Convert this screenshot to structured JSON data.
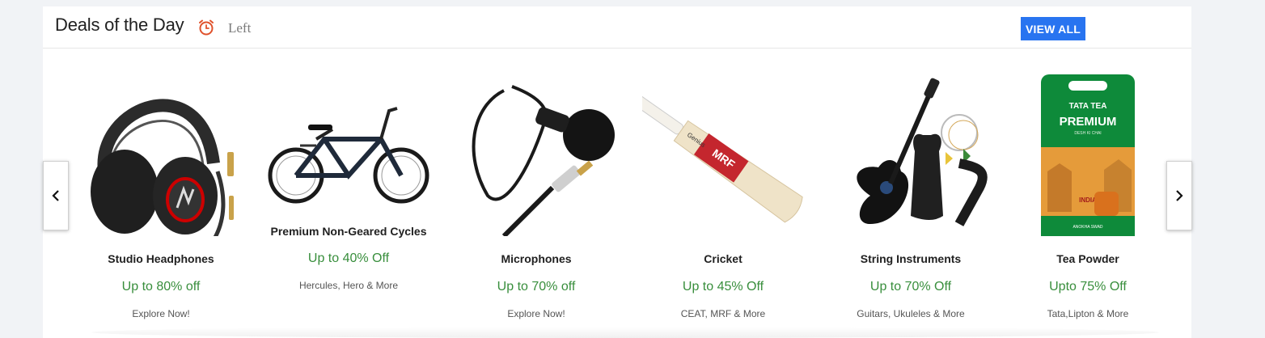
{
  "header": {
    "title": "Deals of the Day",
    "timer_icon": "alarm-clock-icon",
    "time_left_label": "Left",
    "view_all_label": "VIEW ALL"
  },
  "accent_color": "#2874f0",
  "offer_color": "#388e3c",
  "deals": [
    {
      "name": "Studio Headphones",
      "offer": "Up to 80% off",
      "sub": "Explore Now!",
      "image": "headphones-image"
    },
    {
      "name": "Premium Non-Geared Cycles",
      "offer": "Up to 40% Off",
      "sub": "Hercules, Hero & More",
      "image": "bicycle-image"
    },
    {
      "name": "Microphones",
      "offer": "Up to 70% off",
      "sub": "Explore Now!",
      "image": "microphone-image"
    },
    {
      "name": "Cricket",
      "offer": "Up to 45% Off",
      "sub": "CEAT, MRF & More",
      "image": "cricket-bat-image"
    },
    {
      "name": "String Instruments",
      "offer": "Up to 70% Off",
      "sub": "Guitars, Ukuleles & More",
      "image": "guitar-image"
    },
    {
      "name": "Tea Powder",
      "offer": "Upto 75% Off",
      "sub": "Tata,Lipton & More",
      "image": "tea-pack-image"
    }
  ],
  "tea_pack": {
    "brand": "TATA TEA",
    "line": "PREMIUM",
    "tagline": "DESH KI CHAI",
    "sub_brand": "INDIA",
    "footer": "ANOKHA SWAD"
  },
  "bat_brand": "MRF",
  "bat_label": "Genius",
  "nav": {
    "prev_icon": "chevron-left-icon",
    "next_icon": "chevron-right-icon"
  }
}
